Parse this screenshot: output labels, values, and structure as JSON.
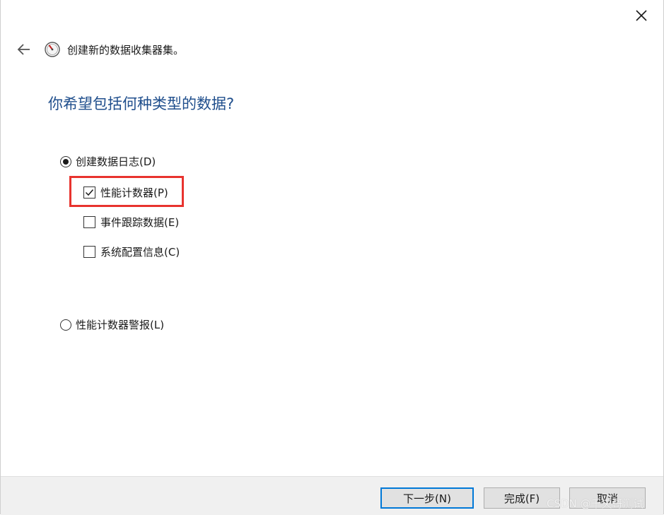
{
  "window": {
    "title": "创建新的数据收集器集。"
  },
  "page": {
    "question": "你希望包括何种类型的数据?"
  },
  "options": {
    "create_log": {
      "label": "创建数据日志(D)",
      "selected": true
    },
    "perf_counter": {
      "label": "性能计数器(P)",
      "checked": true
    },
    "event_trace": {
      "label": "事件跟踪数据(E)",
      "checked": false
    },
    "sys_config": {
      "label": "系统配置信息(C)",
      "checked": false
    },
    "perf_alert": {
      "label": "性能计数器警报(L)",
      "selected": false
    }
  },
  "footer": {
    "next_label": "下一步(N)",
    "finish_label": "完成(F)",
    "cancel_label": "取消"
  },
  "watermark": {
    "text": "CSDN @千央哥测试"
  },
  "colors": {
    "question_text": "#1f4e8c",
    "highlight_border": "#e8332e",
    "default_button_border": "#0078d7"
  },
  "icons": {
    "close": "close-icon",
    "back": "back-arrow-icon",
    "wizard": "performance-monitor-icon"
  }
}
